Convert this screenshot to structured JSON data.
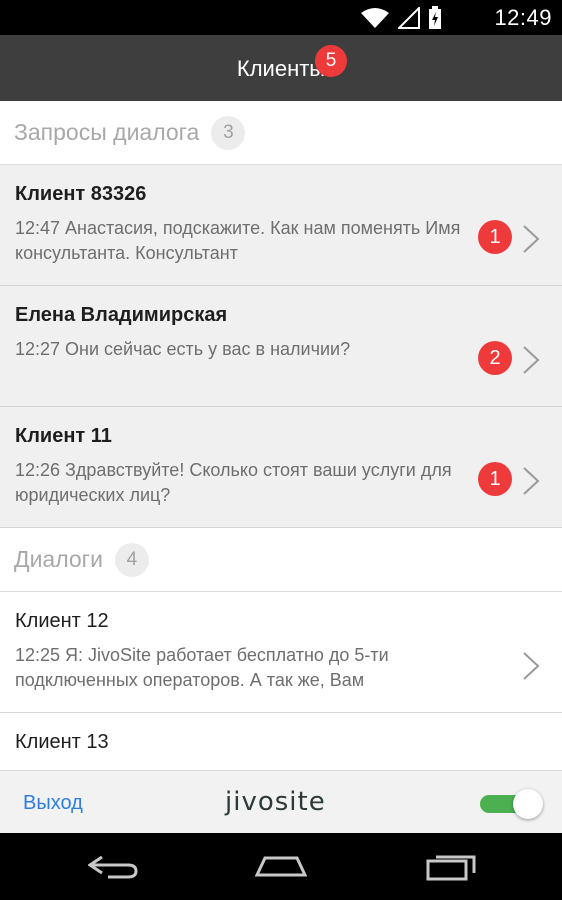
{
  "status_bar": {
    "time": "12:49",
    "icons": [
      "wifi-icon",
      "signal-icon",
      "battery-charging-icon"
    ]
  },
  "header": {
    "title": "Клиенты",
    "badge": "5"
  },
  "requests_section": {
    "label": "Запросы диалога",
    "count": "3"
  },
  "requests": [
    {
      "name": "Клиент 83326",
      "message": "12:47 Анастасия, подскажите. Как нам поменять Имя консультанта. Консультант",
      "unread": "1"
    },
    {
      "name": "Елена Владимирская",
      "message": "12:27 Они сейчас есть у вас в наличии?",
      "unread": "2"
    },
    {
      "name": "Клиент 11",
      "message": "12:26 Здравствуйте! Сколько стоят ваши услуги для юридических лиц?",
      "unread": "1"
    }
  ],
  "dialogs_section": {
    "label": "Диалоги",
    "count": "4"
  },
  "dialogs": [
    {
      "name": "Клиент 12",
      "message": "12:25 Я: JivoSite работает бесплатно до 5-ти подключенных операторов. А так же, Вам"
    },
    {
      "name": "Клиент 13",
      "message": ""
    }
  ],
  "bottom_bar": {
    "exit_label": "Выход",
    "logo_text": "jivosite",
    "toggle_on": true
  },
  "colors": {
    "badge": "#ee3a3a",
    "link": "#2f7fd6",
    "toggle": "#4caf50",
    "header_bg": "#3e3e3e"
  },
  "nav_bar": {
    "icons": [
      "back-icon",
      "home-icon",
      "recent-apps-icon"
    ]
  }
}
